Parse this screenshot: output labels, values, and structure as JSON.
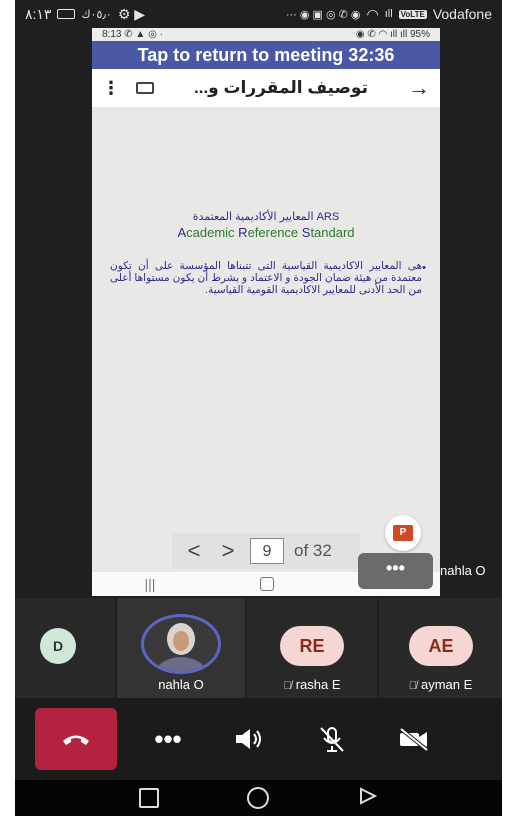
{
  "outer_status": {
    "time": "٨:١٣",
    "network_speed": "٠٥٫٠ك",
    "carrier": "Vodafone",
    "volte": "VoLTE"
  },
  "inner_status": {
    "time": "8:13",
    "battery": "95%"
  },
  "banner": {
    "text": "Tap to return to meeting 32:36"
  },
  "app_bar": {
    "title": "توصيف المقررات و..."
  },
  "slide": {
    "title_ar": "المعايير الأكاديمية المعتمدة ARS",
    "title_en_parts": [
      "A",
      "cademic ",
      "R",
      "eference ",
      "S",
      "tandard"
    ],
    "bullet": "هى المعايير الاكاديمية القياسية التى تتبناها المؤسسة على أن تكون معتمدة من هيئة ضمان الجودة و الاعتماد و بشرط أن يكون مستواها أعلى من الحد الأدنى للمعايير الاكاديمية القومية القياسية."
  },
  "pager": {
    "page": "9",
    "of_total": "of 32"
  },
  "presenter": {
    "more": "•••",
    "name": "nahla O"
  },
  "participants": [
    {
      "initials": "D",
      "name": ""
    },
    {
      "initials": "",
      "name": "nahla O"
    },
    {
      "initials": "RE",
      "name": "rasha E"
    },
    {
      "initials": "AE",
      "name": "ayman E"
    }
  ],
  "controls": {
    "more": "•••"
  },
  "colors": {
    "banner": "#4b58a6",
    "hangup": "#b3233f",
    "avatar_d": "#cfe8d8",
    "avatar_re": "#f6d6d2",
    "avatar_ae": "#f6d6d2"
  }
}
